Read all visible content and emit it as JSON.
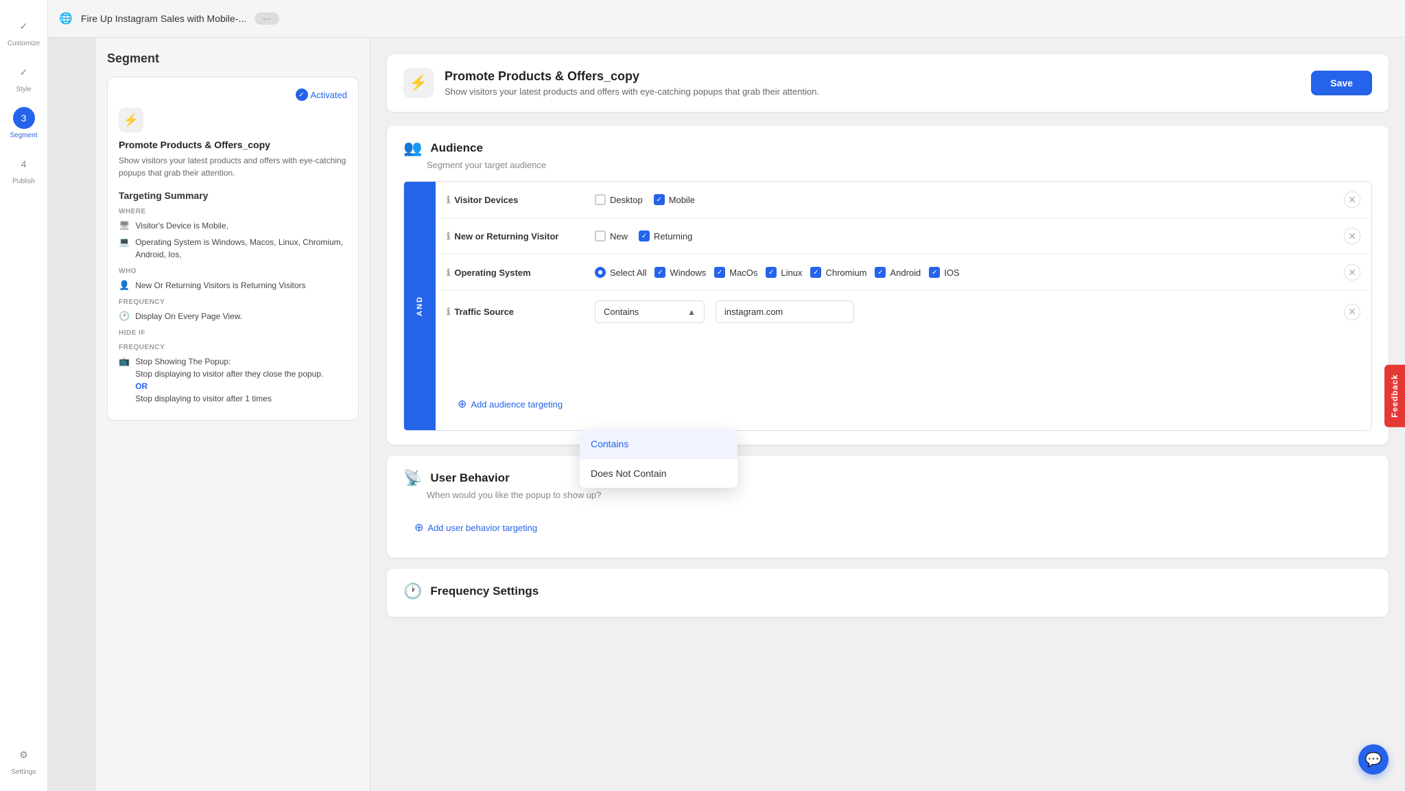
{
  "app": {
    "title": "Fire Up Instagram Sales with Mobile-..."
  },
  "topbar": {
    "globe_icon": "🌐",
    "title": "Fire Up Instagram Sales with Mobile-...",
    "pill": "···"
  },
  "sidebar": {
    "items": [
      {
        "id": "customize",
        "label": "Customize",
        "icon": "✓",
        "active": false
      },
      {
        "id": "style",
        "label": "Style",
        "icon": "✓",
        "active": false
      },
      {
        "id": "segment",
        "label": "Segment",
        "number": "3",
        "active": true
      },
      {
        "id": "publish",
        "label": "Publish",
        "number": "4",
        "active": false
      },
      {
        "id": "settings",
        "label": "Settings",
        "icon": "⚙",
        "active": false
      }
    ]
  },
  "segment_panel": {
    "title": "Segment",
    "campaign": {
      "activated_label": "Activated",
      "name": "Promote Products & Offers_copy",
      "description": "Show visitors your latest products and offers with eye-catching popups that grab their attention."
    },
    "targeting_summary": {
      "title": "Targeting Summary",
      "where_label": "WHERE",
      "where_items": [
        {
          "icon": "🖥",
          "text": "Visitor's Device is  Mobile,"
        },
        {
          "icon": "💻",
          "text": "Operating System is Windows, Macos, Linux, Chromium, Android, Ios,"
        }
      ],
      "who_label": "WHO",
      "who_items": [
        {
          "icon": "👤",
          "text": "New Or Returning Visitors is Returning Visitors"
        }
      ],
      "frequency_label": "FREQUENCY",
      "frequency_items": [
        {
          "icon": "🕐",
          "text": "Display On Every Page View."
        }
      ],
      "hide_if_label": "Hide if",
      "hide_frequency_label": "FREQUENCY",
      "hide_items": [
        {
          "icon": "📺",
          "text": "Stop Showing The Popup: Stop displaying to visitor after they close the popup."
        },
        {
          "or_text": "OR",
          "text": "Stop displaying to visitor after 1 times"
        }
      ]
    }
  },
  "campaign_header": {
    "title": "Promote Products & Offers_copy",
    "description": "Show visitors your latest products and offers with eye-catching popups that grab their attention.",
    "save_label": "Save"
  },
  "audience_section": {
    "title": "Audience",
    "subtitle": "Segment your target audience",
    "and_label": "AND",
    "rows": [
      {
        "id": "visitor-devices",
        "label": "Visitor Devices",
        "options": [
          {
            "label": "Desktop",
            "checked": false,
            "type": "checkbox"
          },
          {
            "label": "Mobile",
            "checked": true,
            "type": "checkbox"
          }
        ]
      },
      {
        "id": "new-returning",
        "label": "New or Returning Visitor",
        "options": [
          {
            "label": "New",
            "checked": false,
            "type": "checkbox"
          },
          {
            "label": "Returning",
            "checked": true,
            "type": "checkbox"
          }
        ]
      },
      {
        "id": "operating-system",
        "label": "Operating System",
        "options": [
          {
            "label": "Select All",
            "checked": false,
            "type": "radio"
          },
          {
            "label": "Windows",
            "checked": true,
            "type": "checkbox"
          },
          {
            "label": "MacOs",
            "checked": true,
            "type": "checkbox"
          },
          {
            "label": "Linux",
            "checked": true,
            "type": "checkbox"
          },
          {
            "label": "Chromium",
            "checked": true,
            "type": "checkbox"
          },
          {
            "label": "Android",
            "checked": true,
            "type": "checkbox"
          },
          {
            "label": "IOS",
            "checked": true,
            "type": "checkbox"
          }
        ]
      },
      {
        "id": "traffic-source",
        "label": "Traffic Source",
        "dropdown_value": "Contains",
        "input_value": "instagram.com",
        "dropdown_options": [
          {
            "label": "Contains",
            "active": true
          },
          {
            "label": "Does Not Contain",
            "active": false
          }
        ]
      }
    ],
    "add_targeting_label": "Add audience targeting"
  },
  "user_behavior": {
    "title": "User Behavior",
    "subtitle": "When would you like the popup to show up?",
    "add_label": "Add user behavior targeting"
  },
  "frequency_settings": {
    "title": "Frequency Settings"
  },
  "feedback_tab": "Feedback",
  "chat_button": "💬"
}
